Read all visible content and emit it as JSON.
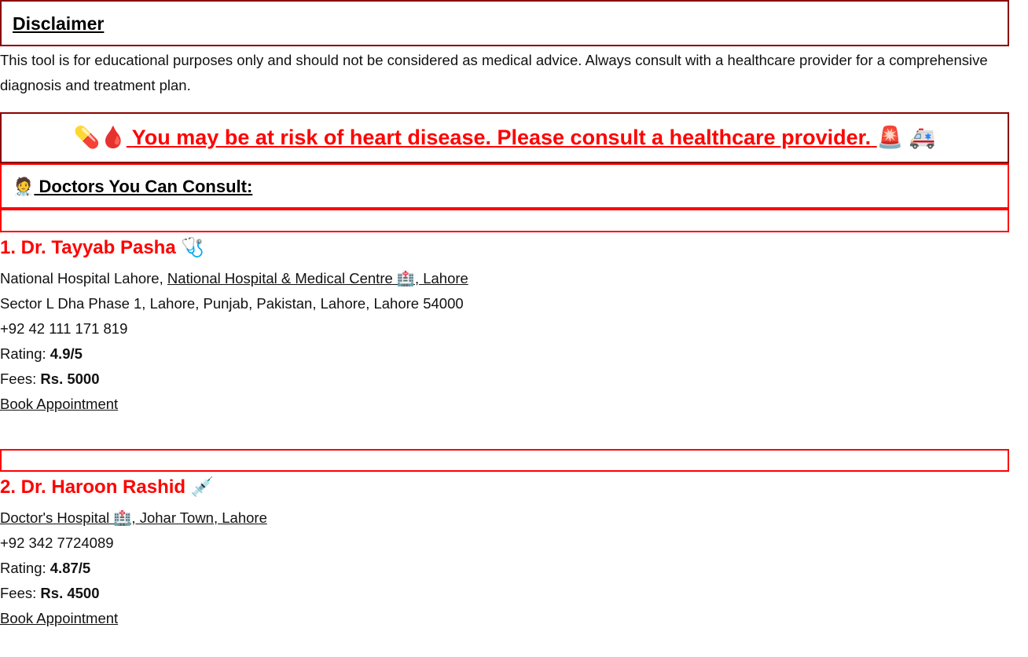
{
  "disclaimer": {
    "title": "Disclaimer",
    "text": "This tool is for educational purposes only and should not be considered as medical advice. Always consult with a healthcare provider for a comprehensive diagnosis and treatment plan."
  },
  "alert": {
    "prefix_icons": "💊🩸",
    "text": "You may be at risk of heart disease. Please consult a healthcare provider.",
    "suffix_icons": "🚨 🚑",
    "color": "#ff0000"
  },
  "doctors_section": {
    "icon": "🧑‍⚕️",
    "title": "Doctors You Can Consult:"
  },
  "doctors": [
    {
      "name": "1. Dr. Tayyab Pasha",
      "name_icon": "🩺",
      "hospital_prefix": "National Hospital Lahore, ",
      "hospital_link": "National Hospital & Medical Centre 🏥, Lahore",
      "address": "Sector L Dha Phase 1, Lahore, Punjab, Pakistan, Lahore, Lahore 54000",
      "phone": "+92 42 111 171 819",
      "rating_label": "Rating: ",
      "rating": "4.9/5",
      "fees_label": "Fees: ",
      "fees": "Rs. 5000",
      "book_label": "Book Appointment"
    },
    {
      "name": "2. Dr. Haroon Rashid",
      "name_icon": "💉",
      "hospital_link": "Doctor's Hospital 🏥, Johar Town, Lahore",
      "phone": "+92 342 7724089",
      "rating_label": "Rating: ",
      "rating": "4.87/5",
      "fees_label": "Fees: ",
      "fees": "Rs. 4500",
      "book_label": "Book Appointment"
    }
  ]
}
